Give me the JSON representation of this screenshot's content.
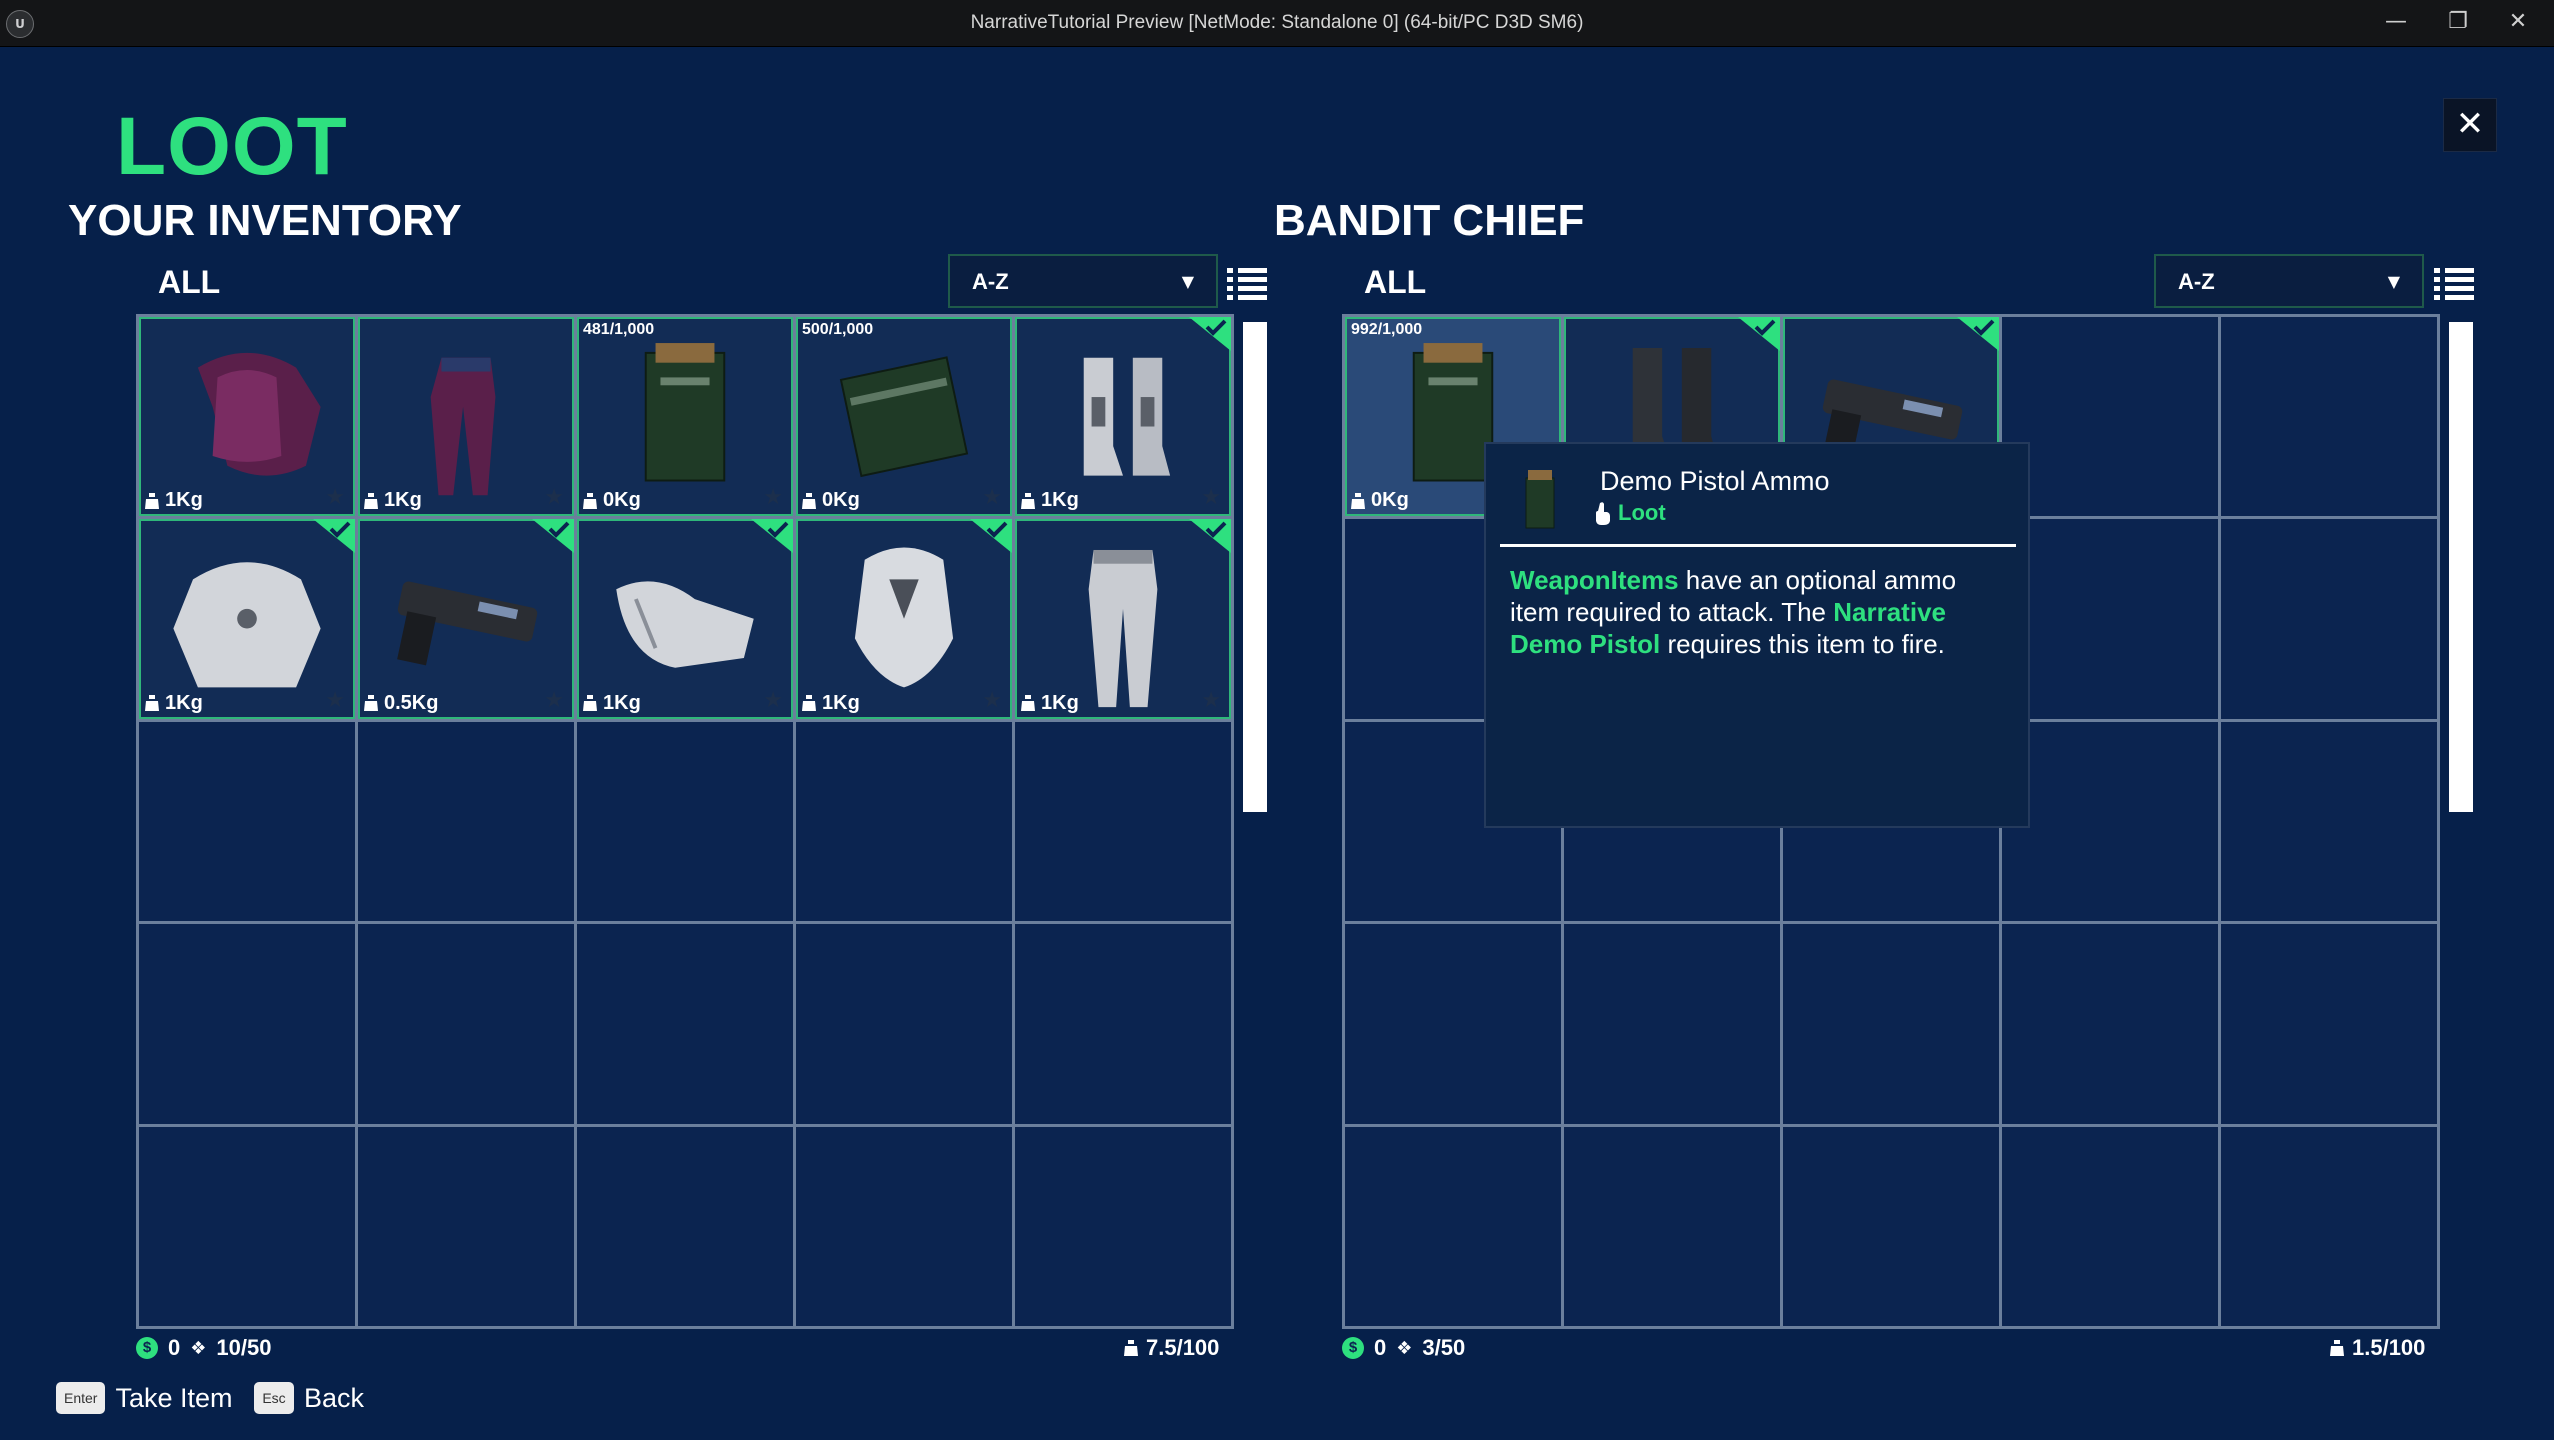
{
  "window": {
    "title": "NarrativeTutorial Preview [NetMode: Standalone 0]  (64-bit/PC D3D SM6)",
    "minimize": "—",
    "restore": "❐",
    "close": "✕"
  },
  "screen": {
    "title": "LOOT",
    "close": "✕"
  },
  "left_panel": {
    "title": "YOUR INVENTORY",
    "filter": "ALL",
    "sort": "A-Z",
    "items": [
      {
        "icon": "purple-chest-armor",
        "weight": "1Kg",
        "stack": "",
        "equipped": false
      },
      {
        "icon": "purple-leg-armor",
        "weight": "1Kg",
        "stack": "",
        "equipped": false
      },
      {
        "icon": "ammo-box",
        "weight": "0Kg",
        "stack": "481/1,000",
        "equipped": false
      },
      {
        "icon": "rifle-ammo-box",
        "weight": "0Kg",
        "stack": "500/1,000",
        "equipped": false
      },
      {
        "icon": "white-boots",
        "weight": "1Kg",
        "stack": "",
        "equipped": true
      },
      {
        "icon": "white-chest-armor",
        "weight": "1Kg",
        "stack": "",
        "equipped": true
      },
      {
        "icon": "pistol",
        "weight": "0.5Kg",
        "stack": "",
        "equipped": true
      },
      {
        "icon": "white-gloves",
        "weight": "1Kg",
        "stack": "",
        "equipped": true
      },
      {
        "icon": "white-helmet",
        "weight": "1Kg",
        "stack": "",
        "equipped": true
      },
      {
        "icon": "white-leg-armor",
        "weight": "1Kg",
        "stack": "",
        "equipped": true
      }
    ],
    "currency": "0",
    "slots": "10/50",
    "weight": "7.5/100",
    "scroll_fraction": 0.48
  },
  "right_panel": {
    "title": "BANDIT CHIEF",
    "filter": "ALL",
    "sort": "A-Z",
    "items": [
      {
        "icon": "ammo-box",
        "weight": "0Kg",
        "stack": "992/1,000",
        "equipped": false
      },
      {
        "icon": "dark-boots",
        "weight": "",
        "stack": "",
        "equipped": true
      },
      {
        "icon": "pistol",
        "weight": "",
        "stack": "",
        "equipped": true
      }
    ],
    "currency": "0",
    "slots": "3/50",
    "weight": "1.5/100",
    "scroll_fraction": 0.48
  },
  "tooltip": {
    "name": "Demo Pistol Ammo",
    "type": "Loot",
    "desc_hl1": "WeaponItems",
    "desc_t1": " have an optional ammo item required to attack. The ",
    "desc_hl2": "Narrative Demo Pistol",
    "desc_t2": " requires this item to fire."
  },
  "hints": {
    "take_key": "Enter",
    "take_label": "Take Item",
    "back_key": "Esc",
    "back_label": "Back"
  },
  "colors": {
    "accent": "#2ee07f",
    "background": "#06204a",
    "slot": "#0b2450",
    "grid_line": "#6b7f9c"
  }
}
